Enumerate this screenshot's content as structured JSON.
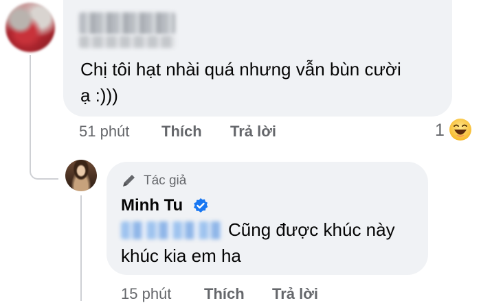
{
  "comment1": {
    "text_line1": "Chị tôi hạt nhài quá nhưng vẫn bùn cười",
    "text_line2": "ạ :)))",
    "time": "51 phút",
    "like_label": "Thích",
    "reply_label": "Trả lời",
    "reaction_count": "1",
    "reaction_icon": "laughing-emoji"
  },
  "reply1": {
    "badge_label": "Tác giả",
    "badge_icon": "pencil-icon",
    "author_name": "Minh Tu",
    "verified_icon": "verified-check-icon",
    "text_line1": "Cũng được khúc này",
    "text_line2": "khúc kia em ha",
    "time": "15 phút",
    "like_label": "Thích",
    "reply_label": "Trả lời"
  },
  "colors": {
    "bubble_bg": "#f0f2f5",
    "meta_text": "#65676b",
    "verified_blue": "#1877f2"
  }
}
